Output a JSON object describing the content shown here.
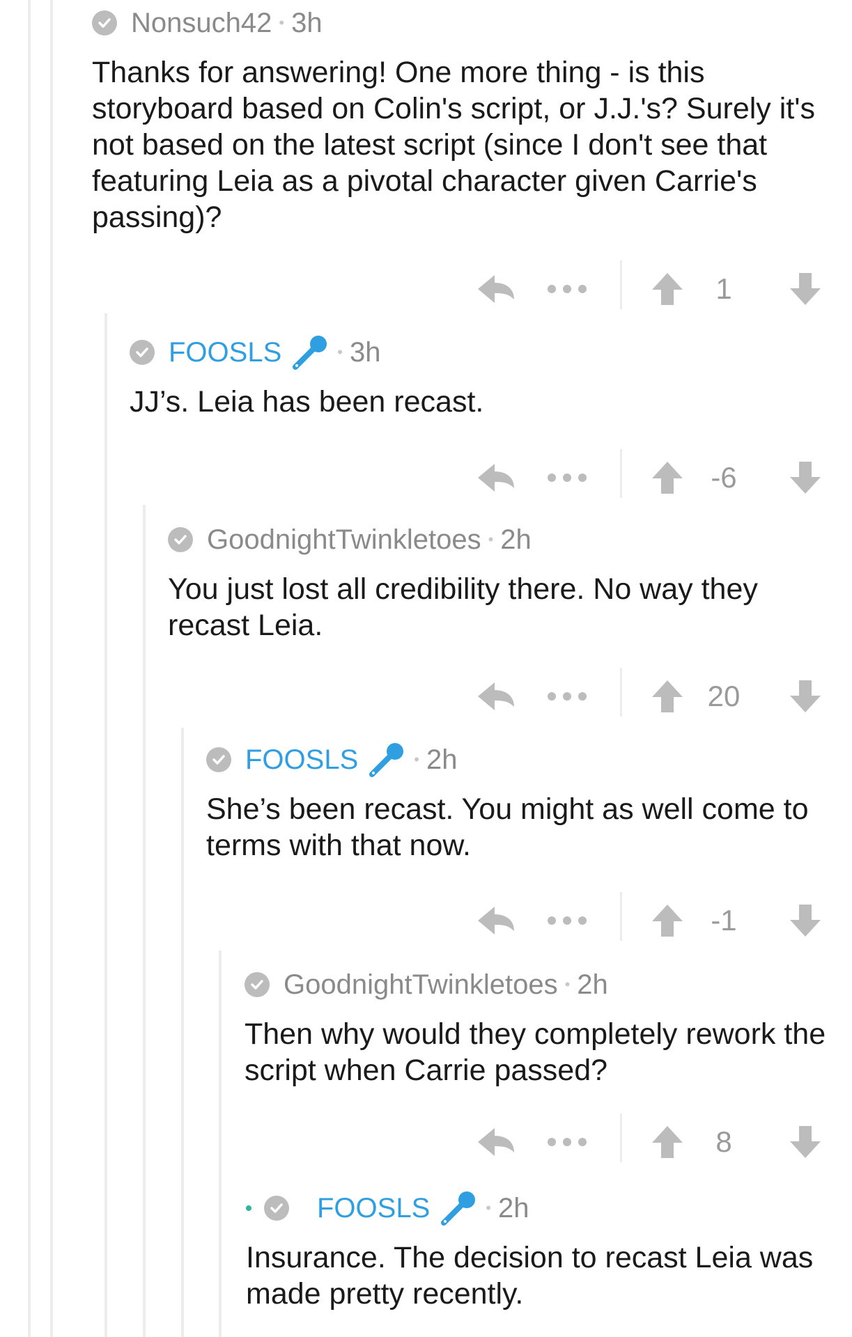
{
  "colors": {
    "op_username": "#2f9fe2",
    "username": "#8a8a8a",
    "icon_gray": "#bcbcbc",
    "guide_line": "#ececec",
    "new_dot": "#2fb59a"
  },
  "comments": [
    {
      "username": "Nonsuch42",
      "time": "3h",
      "body": "Thanks for answering! One more thing - is this storyboard based on Colin's script, or J.J.'s? Surely it's not based on the latest script (since I don't see that featuring Leia as a pivotal character given Carrie's passing)?",
      "score": "1",
      "is_op": false
    },
    {
      "username": "FOOSLS",
      "time": "3h",
      "body": "JJ’s. Leia has been recast.",
      "score": "-6",
      "is_op": true
    },
    {
      "username": "GoodnightTwinkletoes",
      "time": "2h",
      "body": "You just lost all credibility there. No way they recast Leia.",
      "score": "20",
      "is_op": false
    },
    {
      "username": "FOOSLS",
      "time": "2h",
      "body": "She’s been recast. You might as well come to terms with that now.",
      "score": "-1",
      "is_op": true
    },
    {
      "username": "GoodnightTwinkletoes",
      "time": "2h",
      "body": "Then why would they completely rework the script when Carrie passed?",
      "score": "8",
      "is_op": false
    },
    {
      "username": "FOOSLS",
      "time": "2h",
      "body": "Insurance. The decision to recast Leia was made pretty recently.",
      "is_op": true,
      "is_new": true
    }
  ],
  "icons": {
    "verified": "check-circle-icon",
    "mic": "microphone-icon",
    "reply": "reply-arrow-icon",
    "more": "more-dots-icon",
    "upvote": "upvote-arrow-icon",
    "downvote": "downvote-arrow-icon"
  }
}
